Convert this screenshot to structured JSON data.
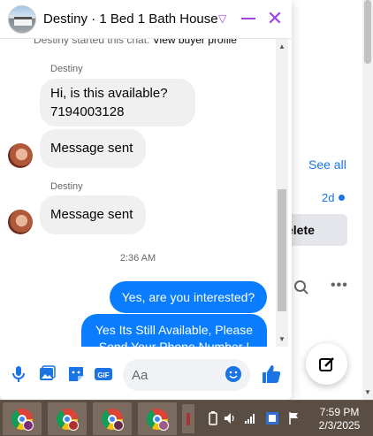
{
  "background_page": {
    "see_all_label": "See all",
    "time_label": "2d",
    "delete_label": "elete",
    "more_label": "•••"
  },
  "chat": {
    "title": "Destiny · 1 Bed 1 Bath House",
    "started_text": "Destiny started this chat. ",
    "view_profile_link": "View buyer profile",
    "messages": [
      {
        "sender": "Destiny",
        "text_line1": "Hi, is this available?",
        "text_line2": "7194003128"
      },
      {
        "text": "Message sent"
      },
      {
        "sender": "Destiny",
        "text": "Message sent"
      }
    ],
    "timestamp": "2:36 AM",
    "outgoing": [
      {
        "text": "Yes, are you interested?"
      },
      {
        "text_line1": "Yes Its Still Available, Please",
        "text_line2": "Send Your Phone Number !"
      }
    ],
    "input_placeholder": "Aa"
  },
  "taskbar": {
    "clock_time": "7:59 PM",
    "clock_date": "2/3/2025"
  },
  "colors": {
    "accent": "#a243e0",
    "messenger_blue": "#0a7cff",
    "link_blue": "#1b74e4",
    "taskbar": "#5a4e44"
  }
}
